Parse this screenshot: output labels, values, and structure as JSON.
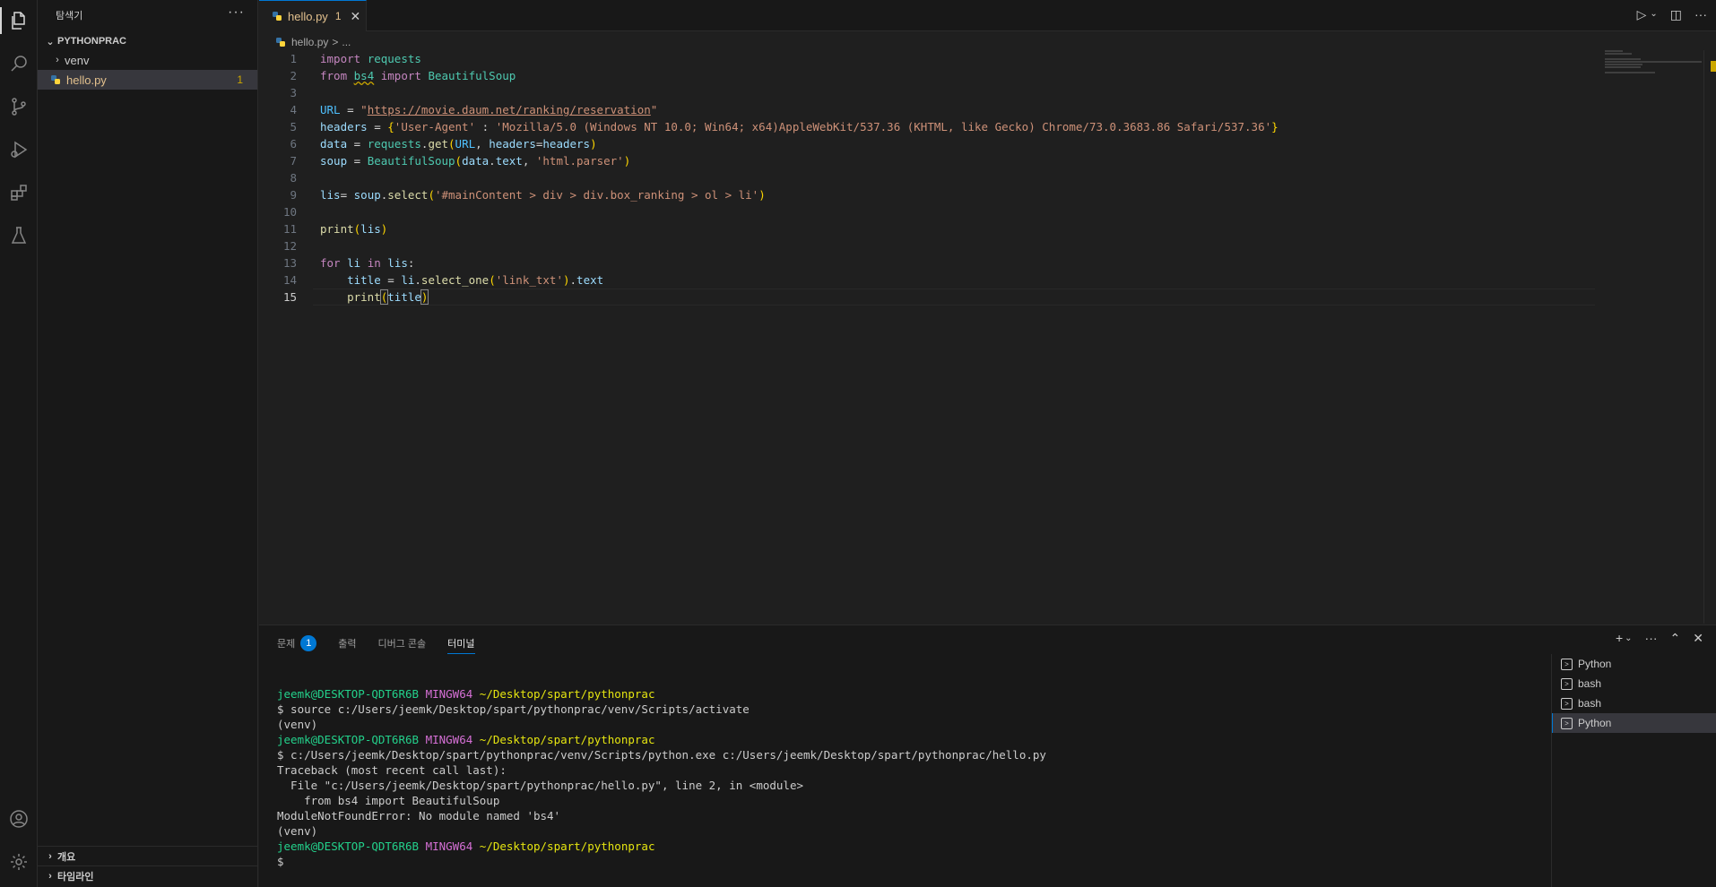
{
  "sidebar": {
    "title": "탐색기",
    "more": "···",
    "folder": "PYTHONPRAC",
    "items": [
      {
        "label": "venv"
      },
      {
        "label": "hello.py",
        "badge": "1"
      }
    ],
    "bottom": [
      {
        "label": "개요"
      },
      {
        "label": "타임라인"
      }
    ]
  },
  "editor": {
    "tab": {
      "label": "hello.py",
      "num": "1",
      "close": "✕"
    },
    "breadcrumb": {
      "file": "hello.py",
      "sep": ">",
      "rest": "..."
    },
    "current_line": 15
  },
  "code": {
    "l1": {
      "kw": "import",
      "mod": "requests"
    },
    "l2": {
      "kw1": "from",
      "mod": "bs4",
      "kw2": "import",
      "cls": "BeautifulSoup"
    },
    "l4": {
      "var": "URL",
      "op": " = ",
      "q": "\"",
      "url": "https://movie.daum.net/ranking/reservation"
    },
    "l5": {
      "var": "headers",
      "op": " = ",
      "key": "'User-Agent'",
      "colon": " : ",
      "val": "'Mozilla/5.0 (Windows NT 10.0; Win64; x64)AppleWebKit/537.36 (KHTML, like Gecko) Chrome/73.0.3683.86 Safari/537.36'"
    },
    "l6": {
      "var": "data",
      "op": " = ",
      "mod": "requests",
      "dot": ".",
      "fn": "get",
      "arg1": "URL",
      "comma": ", ",
      "kwarg": "headers",
      "eq": "=",
      "arg2": "headers"
    },
    "l7": {
      "var": "soup",
      "op": " = ",
      "cls": "BeautifulSoup",
      "a": "data",
      "dot": ".",
      "b": "text",
      "comma": ", ",
      "str": "'html.parser'"
    },
    "l9": {
      "var": "lis",
      "op": "= ",
      "obj": "soup",
      "dot": ".",
      "fn": "select",
      "str": "'#mainContent > div > div.box_ranking > ol > li'"
    },
    "l11": {
      "fn": "print",
      "arg": "lis"
    },
    "l13": {
      "kw1": "for",
      "v": "li",
      "kw2": "in",
      "it": "lis",
      "colon": ":"
    },
    "l14": {
      "indent": "    ",
      "var": "title",
      "op": " = ",
      "obj": "li",
      "dot": ".",
      "fn": "select_one",
      "str": "'link_txt'",
      "dot2": ".",
      "attr": "text"
    },
    "l15": {
      "indent": "    ",
      "fn": "print",
      "arg": "title"
    }
  },
  "panel": {
    "tabs": [
      {
        "label": "문제",
        "badge": "1"
      },
      {
        "label": "출력"
      },
      {
        "label": "디버그 콘솔"
      },
      {
        "label": "터미널"
      }
    ],
    "terminal": {
      "user": "jeemk@DESKTOP-QDT6R6B",
      "sys": "MINGW64",
      "path": "~/Desktop/spart/pythonprac",
      "cmd1": "$ source c:/Users/jeemk/Desktop/spart/pythonprac/venv/Scripts/activate",
      "venv": "(venv)",
      "cmd2": "$ c:/Users/jeemk/Desktop/spart/pythonprac/venv/Scripts/python.exe c:/Users/jeemk/Desktop/spart/pythonprac/hello.py",
      "tb1": "Traceback (most recent call last):",
      "tb2": "  File \"c:/Users/jeemk/Desktop/spart/pythonprac/hello.py\", line 2, in <module>",
      "tb3": "    from bs4 import BeautifulSoup",
      "err": "ModuleNotFoundError: No module named 'bs4'",
      "prompt": "$"
    },
    "terminals": [
      {
        "label": "Python"
      },
      {
        "label": "bash"
      },
      {
        "label": "bash"
      },
      {
        "label": "Python"
      }
    ]
  },
  "colors": {
    "accent": "#0078d4",
    "warning": "#cca700",
    "modified_file": "#e2c08d"
  }
}
